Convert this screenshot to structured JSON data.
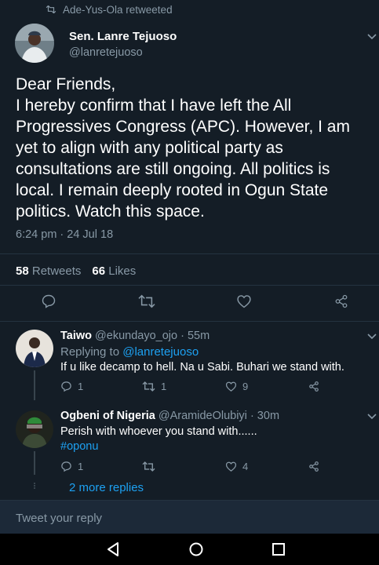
{
  "retweet_context": {
    "text": "Ade-Yus-Ola retweeted"
  },
  "tweet": {
    "author_name": "Sen. Lanre Tejuoso",
    "author_handle": "@lanretejuoso",
    "text": "Dear Friends,\nI hereby confirm that I have left the All Progressives Congress (APC). However, I am yet to align with any political party as consultations are still ongoing. All politics is local. I remain deeply rooted in Ogun State politics. Watch this space.",
    "timestamp": "6:24 pm · 24 Jul 18",
    "retweets_count": "58",
    "retweets_label": "Retweets",
    "likes_count": "66",
    "likes_label": "Likes"
  },
  "replies": [
    {
      "name": "Taiwo",
      "handle": "@ekundayo_ojo",
      "time": "· 55m",
      "replying_to_label": "Replying to",
      "replying_to_handle": "@lanretejuoso",
      "text": "If u like decamp to hell. Na u Sabi. Buhari we stand with.",
      "reply_count": "1",
      "retweet_count": "1",
      "like_count": "9"
    },
    {
      "name": "Ogbeni of Nigeria",
      "handle": "@AramideOlubiyi",
      "time": "· 30m",
      "text": "Perish with whoever you stand with......",
      "hashtag": "#oponu",
      "reply_count": "1",
      "retweet_count": "",
      "like_count": "4"
    }
  ],
  "more_replies": "2 more replies",
  "compose": {
    "placeholder": "Tweet your reply"
  },
  "colors": {
    "background": "#141d26",
    "accent": "#1da1f2",
    "muted": "#8899a6",
    "divider": "#243340"
  },
  "icons": [
    "retweet-icon",
    "chevron-down-icon",
    "reply-icon",
    "like-icon",
    "share-icon",
    "back-icon",
    "home-icon",
    "recents-icon"
  ]
}
